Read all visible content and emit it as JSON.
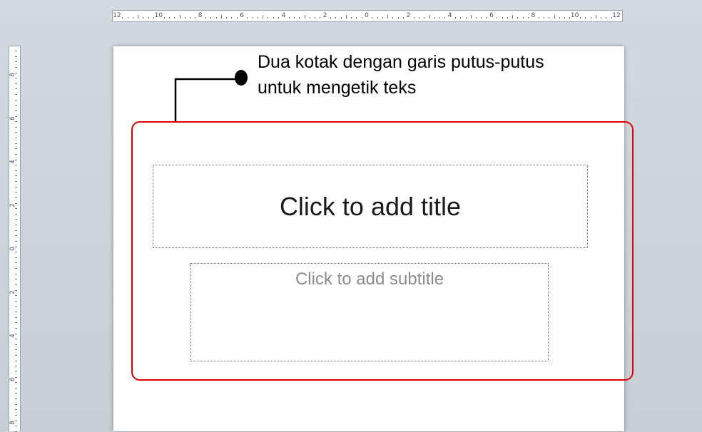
{
  "ruler": {
    "horizontal_labels": [
      "12",
      "10",
      "8",
      "6",
      "4",
      "2",
      "0",
      "2",
      "4",
      "6",
      "8",
      "10",
      "12"
    ],
    "vertical_labels": [
      "8",
      "6",
      "4",
      "2",
      "0",
      "2",
      "4",
      "6",
      "8"
    ]
  },
  "slide": {
    "title_placeholder": "Click to add title",
    "subtitle_placeholder": "Click to add subtitle"
  },
  "annotation": {
    "line1": "Dua kotak dengan garis putus-putus",
    "line2": "untuk mengetik teks"
  },
  "colors": {
    "highlight": "#e00000",
    "workspace": "#c9d0d8"
  }
}
